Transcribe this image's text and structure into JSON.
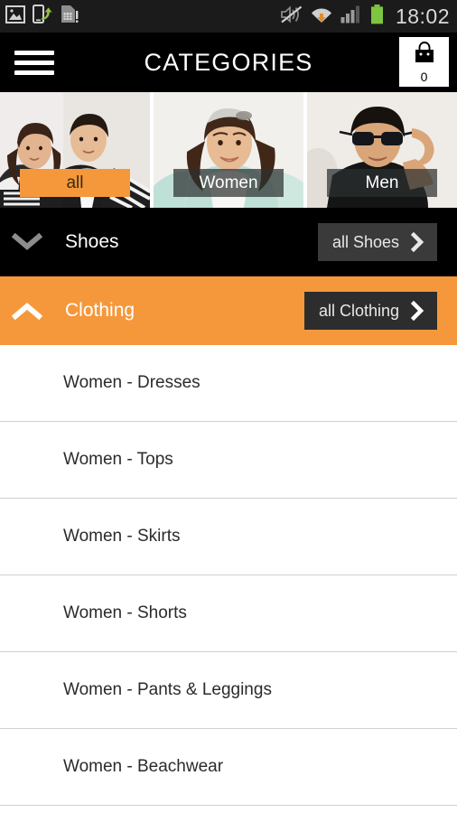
{
  "status_bar": {
    "icons_left": [
      "image-icon",
      "phone-transfer-icon",
      "sim-card-alert-icon"
    ],
    "icons_right": [
      "mute-icon",
      "wifi-download-icon",
      "signal-bars-icon",
      "battery-icon"
    ],
    "time": "18:02",
    "background": "#1b1b1b"
  },
  "header": {
    "menu_icon": "hamburger-menu-icon",
    "title": "CATEGORIES",
    "cart": {
      "icon": "shopping-bag-icon",
      "count": "0"
    },
    "background": "#000000"
  },
  "tiles": [
    {
      "label": "all",
      "selected": true,
      "image": "couple-photo"
    },
    {
      "label": "Women",
      "selected": false,
      "image": "woman-photo"
    },
    {
      "label": "Men",
      "selected": false,
      "image": "man-sunglasses-photo"
    }
  ],
  "categories": [
    {
      "name": "Shoes",
      "expanded": false,
      "chevron": "chevron-down-icon",
      "all_button": "all Shoes",
      "all_button_chevron": "chevron-right-icon",
      "background": "#000000"
    },
    {
      "name": "Clothing",
      "expanded": true,
      "chevron": "chevron-up-icon",
      "all_button": "all Clothing",
      "all_button_chevron": "chevron-right-icon",
      "background": "#f5983b"
    }
  ],
  "subitems": [
    {
      "label": "Women - Dresses"
    },
    {
      "label": "Women - Tops"
    },
    {
      "label": "Women - Skirts"
    },
    {
      "label": "Women - Shorts"
    },
    {
      "label": "Women - Pants & Leggings"
    },
    {
      "label": "Women - Beachwear"
    }
  ],
  "colors": {
    "accent_orange": "#f5983b",
    "header_black": "#000000",
    "status_bar": "#1b1b1b",
    "button_gray": "#3a3a3a",
    "separator": "#cfcfcf"
  }
}
